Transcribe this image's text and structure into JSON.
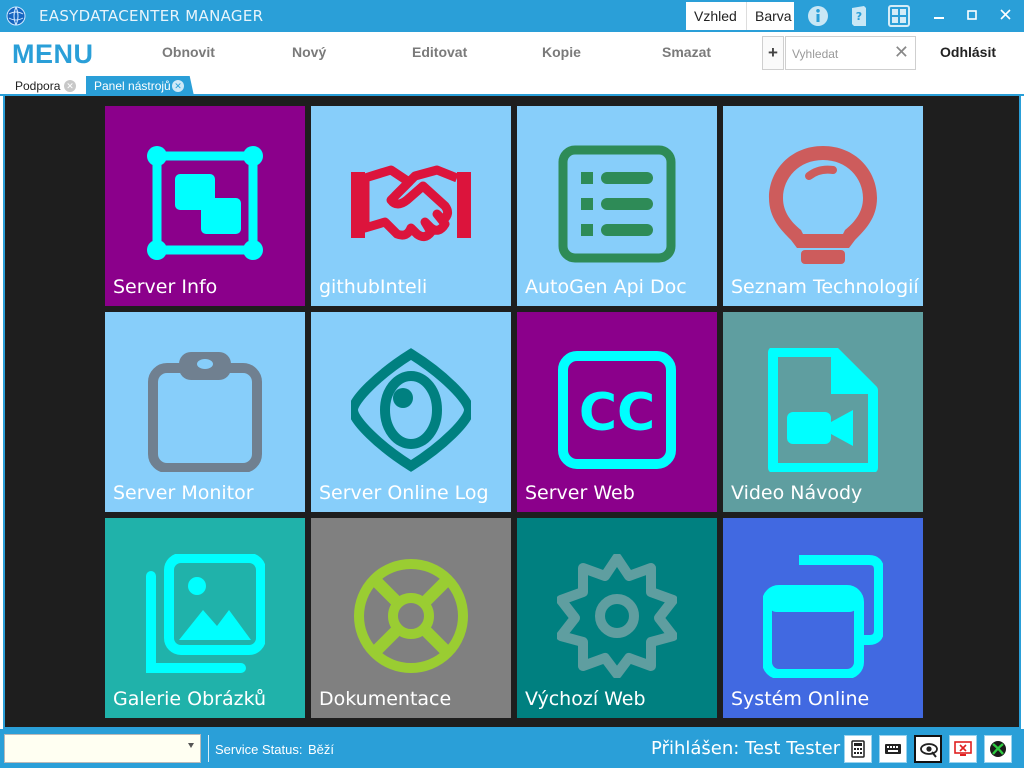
{
  "app": {
    "title": "EASYDATACENTER MANAGER"
  },
  "titlebar": {
    "tabs": [
      "Vzhled",
      "Barva"
    ],
    "icons": [
      "info-icon",
      "help-book-icon",
      "dashboard-icon"
    ],
    "window_buttons": [
      "minimize",
      "maximize",
      "close"
    ]
  },
  "menu": {
    "title": "MENU",
    "items": [
      "Obnovit",
      "Nový",
      "Editovat",
      "Kopie",
      "Smazat"
    ],
    "add_label": "+",
    "search_placeholder": "Vyhledat",
    "search_value": "",
    "logout_label": "Odhlásit"
  },
  "doc_tabs": [
    {
      "label": "Podpora",
      "active": false
    },
    {
      "label": "Panel nástrojů",
      "active": true
    }
  ],
  "tiles": [
    {
      "label": "Server Info",
      "icon": "server-info-icon",
      "bg": "#8b008b",
      "fg": "#00ffff"
    },
    {
      "label": "githubInteli",
      "icon": "handshake-icon",
      "bg": "#87cefa",
      "fg": "#dc143c"
    },
    {
      "label": "AutoGen Api Doc",
      "icon": "list-document-icon",
      "bg": "#87cefa",
      "fg": "#2e8b57"
    },
    {
      "label": "Seznam Technologií",
      "icon": "lightbulb-icon",
      "bg": "#87cefa",
      "fg": "#cd5c5c"
    },
    {
      "label": "Server Monitor",
      "icon": "clipboard-icon",
      "bg": "#87cefa",
      "fg": "#708090"
    },
    {
      "label": "Server Online Log",
      "icon": "eye-icon",
      "bg": "#87cefa",
      "fg": "#008080"
    },
    {
      "label": "Server Web",
      "icon": "closed-caption-icon",
      "bg": "#8b008b",
      "fg": "#00ffff"
    },
    {
      "label": "Video Návody",
      "icon": "video-file-icon",
      "bg": "#5f9ea0",
      "fg": "#00ffff"
    },
    {
      "label": "Galerie Obrázků",
      "icon": "image-gallery-icon",
      "bg": "#20b2aa",
      "fg": "#00ffff"
    },
    {
      "label": "Dokumentace",
      "icon": "lifebuoy-icon",
      "bg": "#808080",
      "fg": "#9acd32"
    },
    {
      "label": "Výchozí Web",
      "icon": "gear-icon",
      "bg": "#008080",
      "fg": "#5f9ea0"
    },
    {
      "label": "Systém Online",
      "icon": "windows-icon",
      "bg": "#4169e1",
      "fg": "#00ffff"
    }
  ],
  "status": {
    "combo_value": "",
    "service_label": "Service Status:",
    "service_value": "Běží",
    "logged_in": "Přihlášen: Test Tester",
    "buttons": [
      "calculator-icon",
      "keyboard-icon",
      "screen-eye-icon",
      "monitor-error-icon",
      "xbox-icon"
    ]
  },
  "colors": {
    "accent": "#2a9fd8",
    "main_bg": "#1e1e1e",
    "status_red": "#e02020"
  }
}
